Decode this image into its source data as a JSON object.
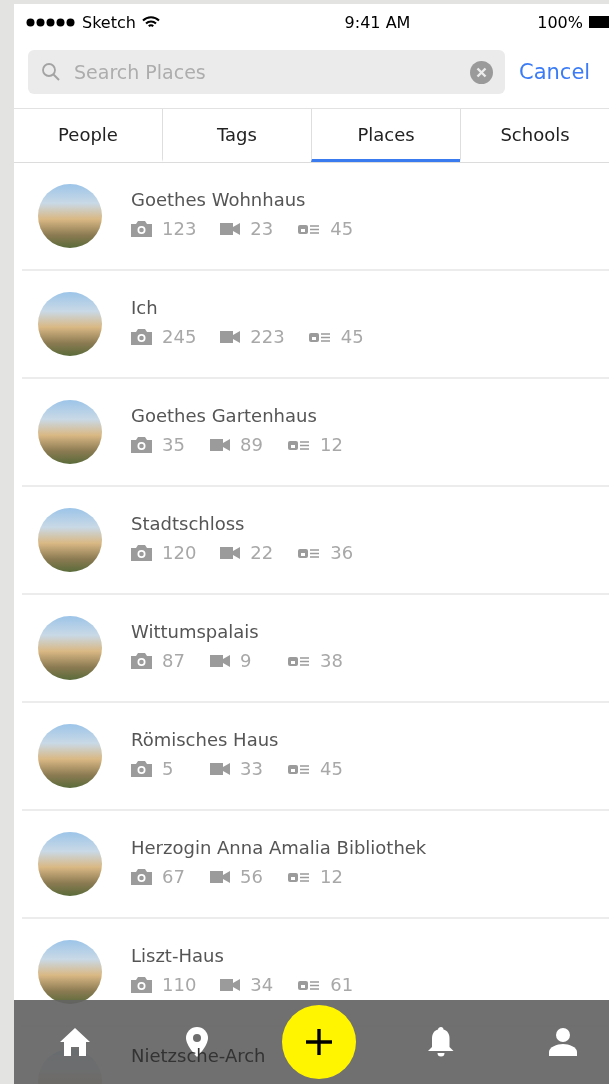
{
  "status_bar": {
    "carrier": "Sketch",
    "time": "9:41 AM",
    "battery": "100%"
  },
  "search": {
    "placeholder": "Search Places",
    "cancel": "Cancel"
  },
  "tabs": [
    {
      "label": "People",
      "selected": false
    },
    {
      "label": "Tags",
      "selected": false
    },
    {
      "label": "Places",
      "selected": true
    },
    {
      "label": "Schools",
      "selected": false
    }
  ],
  "places": [
    {
      "name": "Goethes Wohnhaus",
      "photos": "123",
      "videos": "23",
      "entries": "45"
    },
    {
      "name": "Ich",
      "photos": "245",
      "videos": "223",
      "entries": "45"
    },
    {
      "name": "Goethes Gartenhaus",
      "photos": "35",
      "videos": "89",
      "entries": "12"
    },
    {
      "name": "Stadtschloss",
      "photos": "120",
      "videos": "22",
      "entries": "36"
    },
    {
      "name": "Wittumspalais",
      "photos": "87",
      "videos": "9",
      "entries": "38"
    },
    {
      "name": "Römisches Haus",
      "photos": "5",
      "videos": "33",
      "entries": "45"
    },
    {
      "name": "Herzogin Anna Amalia Bibliothek",
      "photos": "67",
      "videos": "56",
      "entries": "12"
    },
    {
      "name": "Liszt-Haus",
      "photos": "110",
      "videos": "34",
      "entries": "61"
    },
    {
      "name": "Nietzsche-Arch"
    }
  ]
}
